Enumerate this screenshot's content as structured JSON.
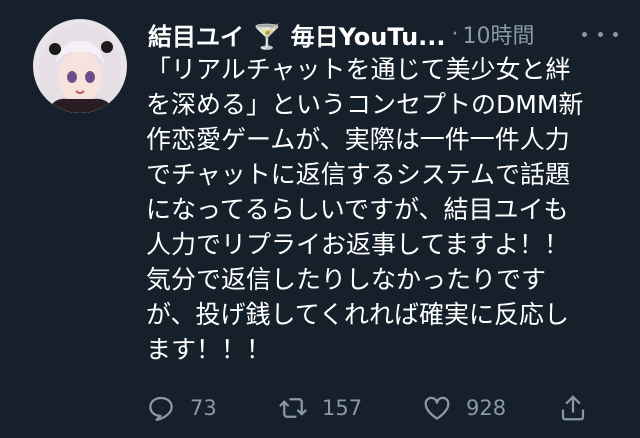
{
  "tweet": {
    "display_name": "結目ユイ 🍸 毎日YouTu...",
    "separator": "·",
    "timestamp": "10時間",
    "body_lines": [
      "「リアルチャットを通じて美少女と絆",
      "を深める」というコンセプトのDMM新",
      "作恋愛ゲームが、実際は一件一件人力",
      "でチャットに返信するシステムで話題",
      "になってるらしいですが、結目ユイも",
      "人力でリプライお返事してますよ！！",
      "気分で返信したりしなかったりです",
      "が、投げ銭してくれれば確実に反応し",
      "ます！！！"
    ],
    "replies": "73",
    "retweets": "157",
    "likes": "928"
  },
  "icons": {
    "more": "more-horizontal-icon",
    "reply": "reply-icon",
    "retweet": "retweet-icon",
    "like": "heart-icon",
    "share": "share-icon"
  },
  "colors": {
    "background": "#15202b",
    "text": "#ffffff",
    "secondary": "#8b98a5"
  }
}
